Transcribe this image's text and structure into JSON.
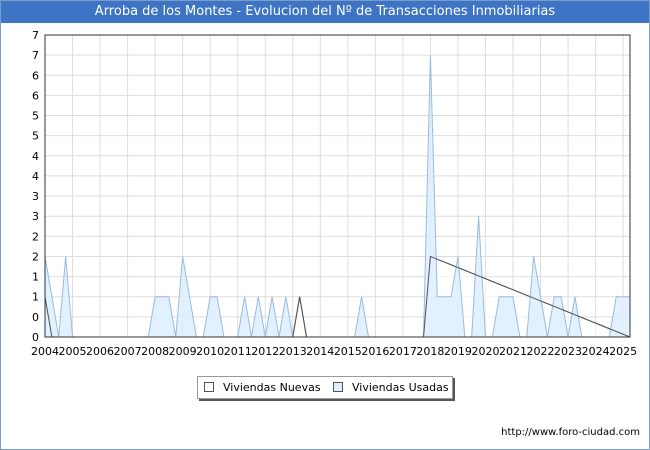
{
  "header": {
    "title": "Arroba de los Montes - Evolucion del Nº de Transacciones Inmobiliarias"
  },
  "footer": {
    "url": "http://www.foro-ciudad.com"
  },
  "chart_data": {
    "type": "area",
    "title": "Arroba de los Montes - Evolucion del Nº de Transacciones Inmobiliarias",
    "xlabel": "",
    "ylabel": "",
    "x_range": [
      2004.0,
      2025.25
    ],
    "ylim": [
      0,
      7.5
    ],
    "grid": true,
    "legend_position": "bottom-center",
    "x_ticks": [
      "2004",
      "2005",
      "2006",
      "2007",
      "2008",
      "2009",
      "2010",
      "2011",
      "2012",
      "2013",
      "2014",
      "2015",
      "2016",
      "2017",
      "2018",
      "2019",
      "2020",
      "2021",
      "2022",
      "2023",
      "2024",
      "2025"
    ],
    "y_tick_values": [
      0,
      0.5,
      1,
      1.5,
      2,
      2.5,
      3,
      3.5,
      4,
      4.5,
      5,
      5.5,
      6,
      6.5,
      7,
      7.5
    ],
    "y_tick_labels": [
      "0",
      "0",
      "1",
      "1",
      "2",
      "2",
      "3",
      "3",
      "4",
      "4",
      "5",
      "5",
      "6",
      "6",
      "7",
      "7"
    ],
    "series": [
      {
        "name": "Viviendas Nuevas",
        "color": "#ffffff",
        "line_color": "#555555",
        "x": [
          2004.0,
          2004.25,
          2013.0,
          2013.25,
          2013.5,
          2017.5,
          2017.75,
          2018.0,
          2025.25
        ],
        "y": [
          1,
          0,
          0,
          1,
          0,
          0,
          0,
          2,
          0
        ]
      },
      {
        "name": "Viviendas Usadas",
        "color": "#ddeeff",
        "line_color": "#99bbdd",
        "x": [
          2004.0,
          2004.5,
          2004.75,
          2005.0,
          2007.75,
          2008.0,
          2008.5,
          2008.75,
          2009.0,
          2009.5,
          2009.75,
          2010.0,
          2010.25,
          2010.5,
          2011.0,
          2011.25,
          2011.5,
          2011.75,
          2012.0,
          2012.25,
          2012.5,
          2012.75,
          2013.0,
          2015.25,
          2015.5,
          2015.75,
          2017.5,
          2017.75,
          2018.0,
          2018.25,
          2018.5,
          2018.75,
          2019.0,
          2019.25,
          2019.5,
          2019.75,
          2020.0,
          2020.25,
          2020.5,
          2021.0,
          2021.25,
          2021.5,
          2021.75,
          2022.0,
          2022.25,
          2022.5,
          2022.75,
          2023.0,
          2023.25,
          2023.5,
          2023.75,
          2024.5,
          2024.75,
          2025.0,
          2025.25
        ],
        "y": [
          2,
          0,
          2,
          0,
          0,
          1,
          1,
          0,
          2,
          0,
          0,
          1,
          1,
          0,
          0,
          1,
          0,
          1,
          0,
          1,
          0,
          1,
          0,
          0,
          1,
          0,
          0,
          0,
          7,
          1,
          1,
          1,
          2,
          0,
          0,
          3,
          0,
          0,
          1,
          1,
          0,
          0,
          2,
          1,
          0,
          1,
          1,
          0,
          1,
          0,
          0,
          0,
          1,
          1,
          1
        ]
      }
    ]
  }
}
